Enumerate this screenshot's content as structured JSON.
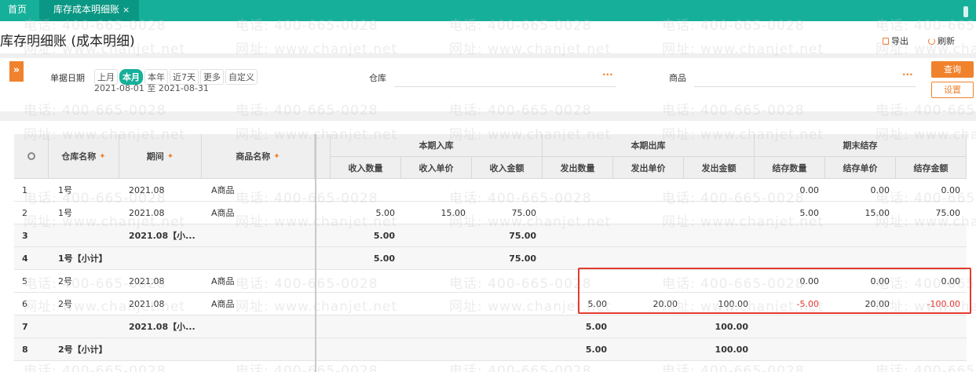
{
  "tabs": {
    "home_label": "首页",
    "active_label": "库存成本明细账",
    "close_glyph": "×"
  },
  "page": {
    "title": "库存明细账 (成本明细)",
    "export_label": "导出",
    "refresh_label": "刷新"
  },
  "filters": {
    "expand_glyph": "»",
    "date_label": "单据日期",
    "date_options": [
      "上月",
      "本月",
      "本年",
      "近7天",
      "更多",
      "自定义"
    ],
    "date_active": "本月",
    "date_range": "2021-08-01 至 2021-08-31",
    "warehouse_label": "仓库",
    "product_label": "商品",
    "ellipsis": "···",
    "query_button": "查询",
    "settings_button": "设置"
  },
  "watermark": {
    "line1": "电话: 400-665-0028",
    "line2": "网址: www.chanjet.net"
  },
  "table": {
    "headers": {
      "warehouse": "仓库名称",
      "period": "期间",
      "product": "商品名称",
      "group_in": "本期入库",
      "group_out": "本期出库",
      "group_end": "期末结存",
      "in_qty": "收入数量",
      "in_price": "收入单价",
      "in_amount": "收入金额",
      "out_qty": "发出数量",
      "out_price": "发出单价",
      "out_amount": "发出金额",
      "end_qty": "结存数量",
      "end_price": "结存单价",
      "end_amount": "结存金额"
    },
    "rows": [
      {
        "no": "1",
        "warehouse": "1号",
        "period": "2021.08",
        "product": "A商品",
        "in_qty": "",
        "in_price": "",
        "in_amount": "",
        "out_qty": "",
        "out_price": "",
        "out_amount": "",
        "end_qty": "0.00",
        "end_price": "0.00",
        "end_amount": "0.00",
        "subtotal": false
      },
      {
        "no": "2",
        "warehouse": "1号",
        "period": "2021.08",
        "product": "A商品",
        "in_qty": "5.00",
        "in_price": "15.00",
        "in_amount": "75.00",
        "out_qty": "",
        "out_price": "",
        "out_amount": "",
        "end_qty": "5.00",
        "end_price": "15.00",
        "end_amount": "75.00",
        "subtotal": false
      },
      {
        "no": "3",
        "warehouse": "",
        "period": "2021.08【小...",
        "product": "",
        "in_qty": "5.00",
        "in_price": "",
        "in_amount": "75.00",
        "out_qty": "",
        "out_price": "",
        "out_amount": "",
        "end_qty": "",
        "end_price": "",
        "end_amount": "",
        "subtotal": true
      },
      {
        "no": "4",
        "warehouse": "1号【小计】",
        "period": "",
        "product": "",
        "in_qty": "5.00",
        "in_price": "",
        "in_amount": "75.00",
        "out_qty": "",
        "out_price": "",
        "out_amount": "",
        "end_qty": "",
        "end_price": "",
        "end_amount": "",
        "subtotal": true
      },
      {
        "no": "5",
        "warehouse": "2号",
        "period": "2021.08",
        "product": "A商品",
        "in_qty": "",
        "in_price": "",
        "in_amount": "",
        "out_qty": "",
        "out_price": "",
        "out_amount": "",
        "end_qty": "0.00",
        "end_price": "0.00",
        "end_amount": "0.00",
        "subtotal": false
      },
      {
        "no": "6",
        "warehouse": "2号",
        "period": "2021.08",
        "product": "A商品",
        "in_qty": "",
        "in_price": "",
        "in_amount": "",
        "out_qty": "5.00",
        "out_price": "20.00",
        "out_amount": "100.00",
        "end_qty": "-5.00",
        "end_price": "20.00",
        "end_amount": "-100.00",
        "subtotal": false
      },
      {
        "no": "7",
        "warehouse": "",
        "period": "2021.08【小...",
        "product": "",
        "in_qty": "",
        "in_price": "",
        "in_amount": "",
        "out_qty": "5.00",
        "out_price": "",
        "out_amount": "100.00",
        "end_qty": "",
        "end_price": "",
        "end_amount": "",
        "subtotal": true
      },
      {
        "no": "8",
        "warehouse": "2号【小计】",
        "period": "",
        "product": "",
        "in_qty": "",
        "in_price": "",
        "in_amount": "",
        "out_qty": "5.00",
        "out_price": "",
        "out_amount": "100.00",
        "end_qty": "",
        "end_price": "",
        "end_amount": "",
        "subtotal": true
      }
    ]
  },
  "colors": {
    "brand": "#16b09a",
    "accent": "#f0822d",
    "negative": "#e8322c",
    "highlight_box": "#e23b2e"
  }
}
